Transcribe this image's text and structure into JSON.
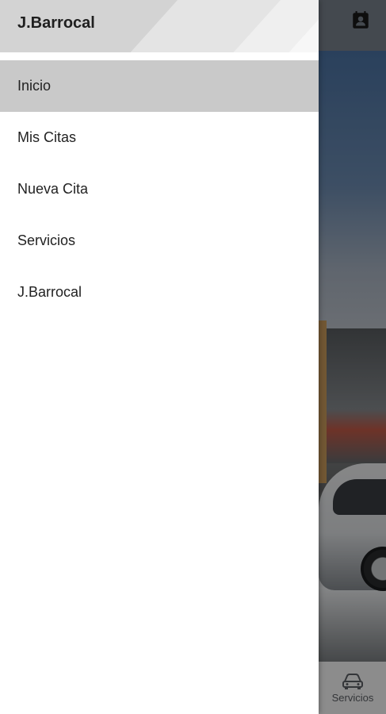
{
  "drawer": {
    "title": "J.Barrocal",
    "items": [
      {
        "label": "Inicio",
        "active": true
      },
      {
        "label": "Mis Citas",
        "active": false
      },
      {
        "label": "Nueva Cita",
        "active": false
      },
      {
        "label": "Servicios",
        "active": false
      },
      {
        "label": "J.Barrocal",
        "active": false
      }
    ]
  },
  "topbar": {
    "action_icon": "contact-card-icon"
  },
  "bottom_nav": {
    "items": [
      {
        "label": "Servicios",
        "icon": "car-icon"
      }
    ]
  },
  "colors": {
    "drawer_active_bg": "#c9c9c9",
    "scrim": "rgba(0,0,0,0.45)"
  }
}
